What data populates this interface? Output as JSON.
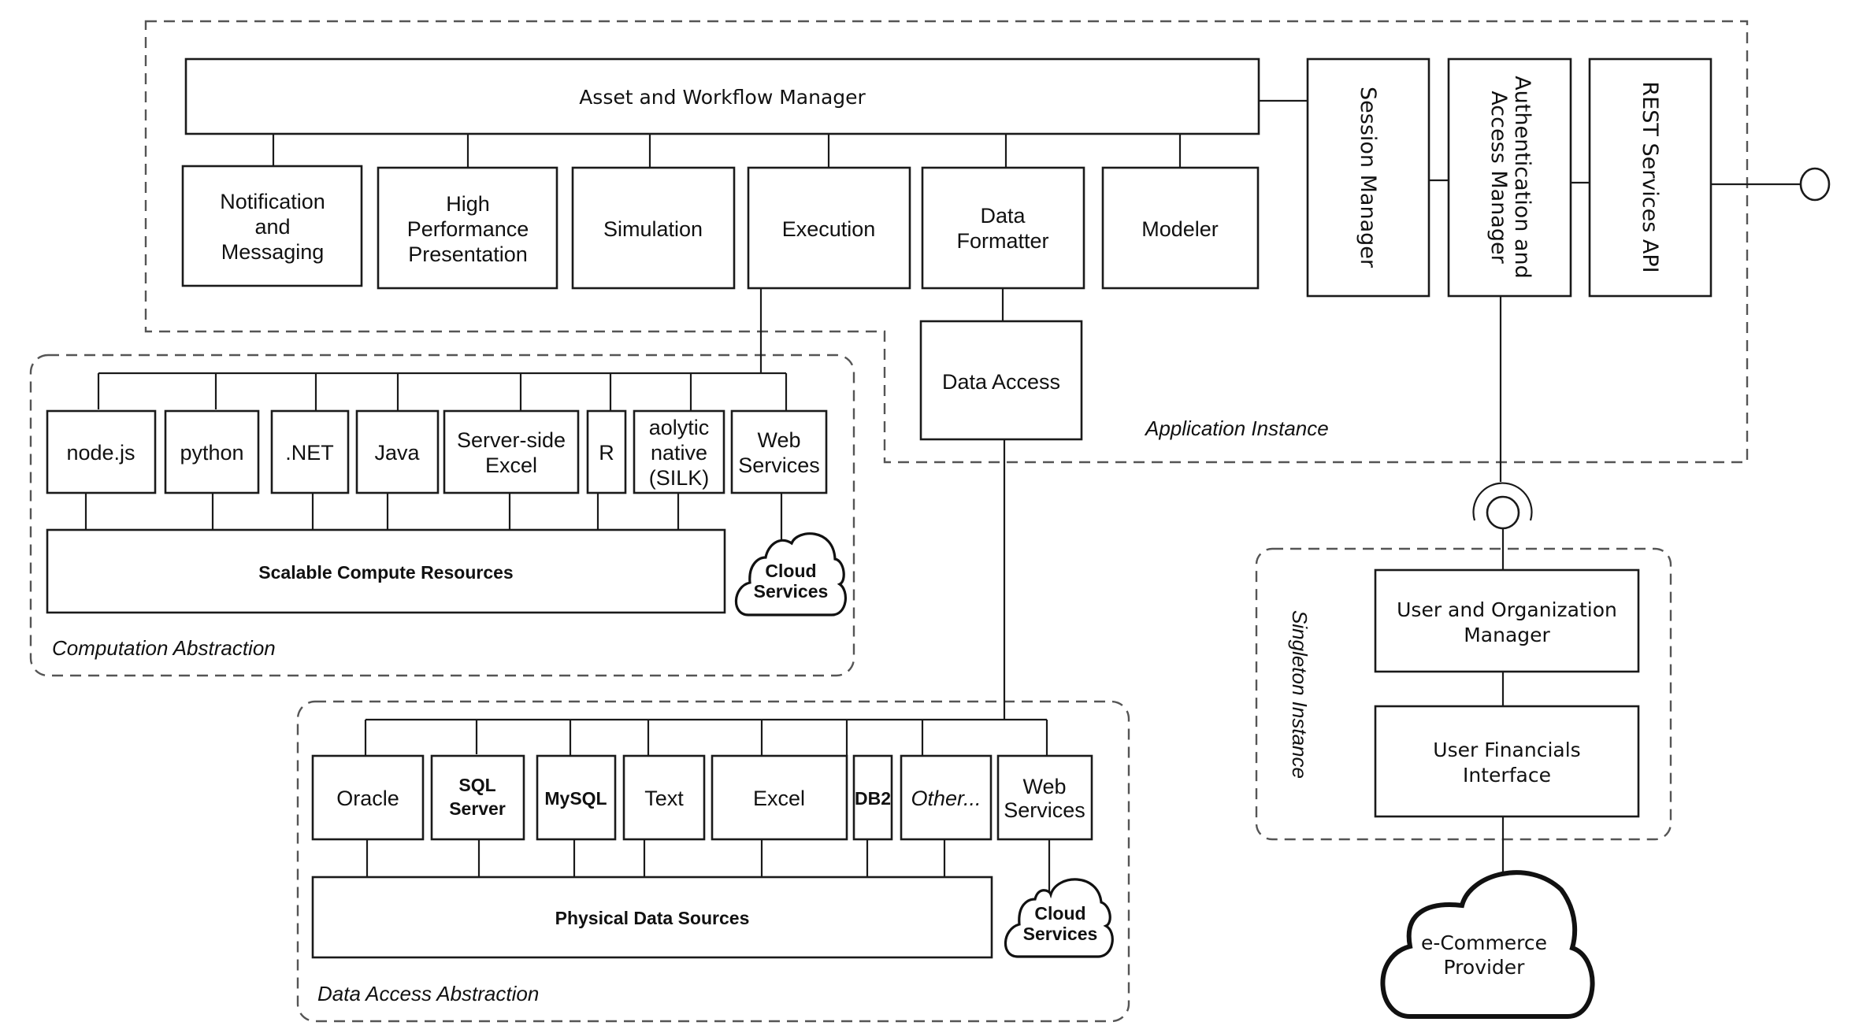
{
  "groups": {
    "application_instance": "Application Instance",
    "computation_abstraction": "Computation Abstraction",
    "data_access_abstraction": "Data Access Abstraction",
    "singleton_instance": "Singleton Instance"
  },
  "application": {
    "asset_manager": "Asset and Workflow Manager",
    "modules": [
      {
        "lines": [
          "Notification",
          "and",
          "Messaging"
        ]
      },
      {
        "lines": [
          "High",
          "Performance",
          "Presentation"
        ]
      },
      {
        "lines": [
          "Simulation"
        ]
      },
      {
        "lines": [
          "Execution"
        ]
      },
      {
        "lines": [
          "Data",
          "Formatter"
        ]
      },
      {
        "lines": [
          "Modeler"
        ]
      }
    ],
    "data_access": "Data Access",
    "session_manager": "Session Manager",
    "auth_manager": [
      "Authentication and",
      "Access Manager"
    ],
    "rest_api": "REST Services API"
  },
  "computation": {
    "engines": [
      {
        "lines": [
          "node.js"
        ]
      },
      {
        "lines": [
          "python"
        ]
      },
      {
        "lines": [
          ".NET"
        ]
      },
      {
        "lines": [
          "Java"
        ]
      },
      {
        "lines": [
          "Server-side",
          "Excel"
        ]
      },
      {
        "lines": [
          "R"
        ]
      },
      {
        "lines": [
          "aolytic",
          "native",
          "(SILK)"
        ]
      },
      {
        "lines": [
          "Web",
          "Services"
        ]
      }
    ],
    "resources": "Scalable Compute Resources",
    "cloud": [
      "Cloud",
      "Services"
    ]
  },
  "data_sources": {
    "sources": [
      {
        "lines": [
          "Oracle"
        ]
      },
      {
        "lines": [
          "SQL",
          "Server"
        ]
      },
      {
        "lines": [
          "MySQL"
        ]
      },
      {
        "lines": [
          "Text"
        ]
      },
      {
        "lines": [
          "Excel"
        ]
      },
      {
        "lines": [
          "DB2"
        ]
      },
      {
        "lines": [
          "Other..."
        ]
      },
      {
        "lines": [
          "Web",
          "Services"
        ]
      }
    ],
    "physical": "Physical Data Sources",
    "cloud": [
      "Cloud",
      "Services"
    ]
  },
  "singleton": {
    "user_org": [
      "User and Organization",
      "Manager"
    ],
    "financials": [
      "User Financials",
      "Interface"
    ]
  },
  "ecommerce": [
    "e-Commerce",
    "Provider"
  ]
}
